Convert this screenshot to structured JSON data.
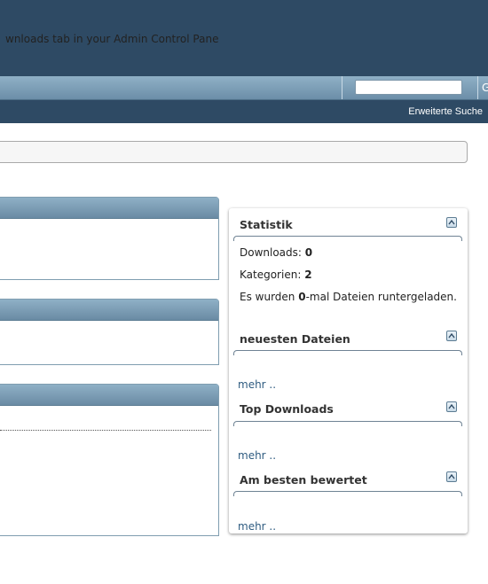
{
  "header": {
    "advanced_search": "Erweiterte Suche",
    "search": {
      "value": "",
      "go_label": "G"
    }
  },
  "main": {
    "panel_1_text": "wnloads tab in your Admin Control Panel."
  },
  "sidebar": {
    "stats": {
      "title": "Statistik",
      "downloads_label": "Downloads:",
      "downloads_value": "0",
      "categories_label": "Kategorien:",
      "categories_value": "2",
      "total_prefix": "Es wurden ",
      "total_value": "0",
      "total_suffix": "-mal Dateien runtergeladen."
    },
    "newest": {
      "title": "neuesten Dateien",
      "more": "mehr .."
    },
    "top": {
      "title": "Top Downloads",
      "more": "mehr .."
    },
    "best": {
      "title": "Am besten bewertet",
      "more": "mehr .."
    }
  },
  "colors": {
    "header": "#2e4a64",
    "navbar": "#7c9db5",
    "link": "#2e5b80"
  }
}
